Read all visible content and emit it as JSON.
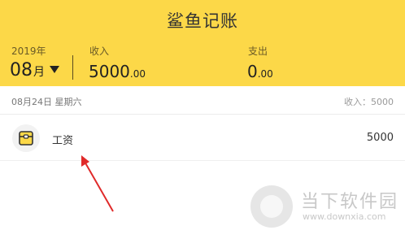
{
  "app": {
    "title": "鲨鱼记账"
  },
  "summary": {
    "year": "2019年",
    "month": "08",
    "month_suffix": "月",
    "income_label": "收入",
    "income_int": "5000",
    "income_dec": ".00",
    "expense_label": "支出",
    "expense_int": "0",
    "expense_dec": ".00"
  },
  "day": {
    "date": "08月24日 星期六",
    "income": "收入：5000"
  },
  "records": [
    {
      "category": "工资",
      "amount": "5000",
      "icon": "wallet-icon"
    }
  ],
  "watermark": {
    "text": "当下软件园",
    "url": "www.downxia.com"
  },
  "colors": {
    "accent": "#fcd848",
    "arrow": "#e02a2a"
  }
}
